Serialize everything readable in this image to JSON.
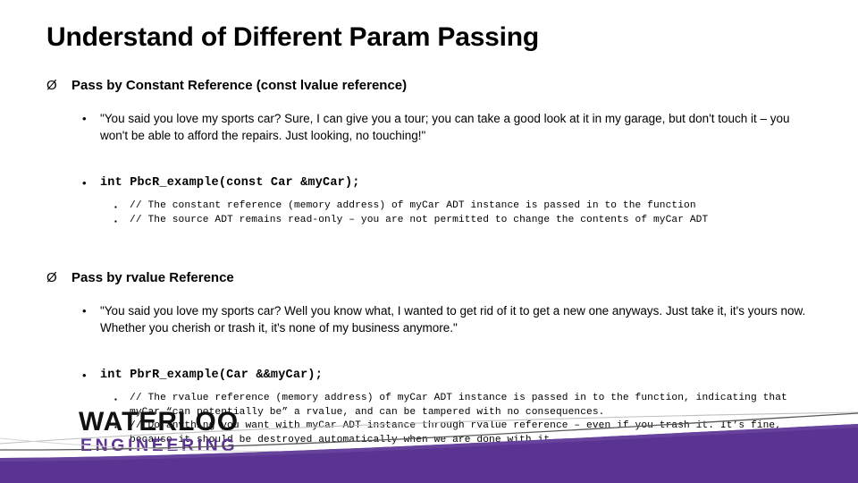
{
  "slide": {
    "title": "Understand of Different Param Passing",
    "markers": {
      "arrow": "Ø",
      "dot": "•",
      "square": "▪"
    },
    "sections": [
      {
        "heading": "Pass by Constant Reference (const lvalue reference)",
        "quote": "\"You said you love my sports car? Sure, I can give you a tour; you can take a good look at it in my garage, but don't touch it – you won't be able to afford the repairs.  Just looking, no touching!\"",
        "code": "int PbcR_example(const Car &myCar);",
        "comments": [
          "// The constant reference (memory address) of myCar ADT instance is passed in to the function",
          "// The source ADT remains read-only – you are not permitted to change the contents of myCar ADT"
        ]
      },
      {
        "heading": "Pass by rvalue Reference",
        "quote": "\"You said you love my sports car? Well you know what, I wanted to get rid of it to get a new one anyways.  Just take it, it's yours now.  Whether you cherish or trash it, it's none of my business anymore.\"",
        "code": "int PbrR_example(Car &&myCar);",
        "comments": [
          "// The rvalue reference (memory address) of myCar ADT instance is passed in to the function, indicating that myCar “can potentially be” a rvalue, and can be tampered with no consequences.",
          "// Do anything you want with myCar ADT instance through rvalue reference – even if you trash it. It’s fine, because it should be destroyed automatically when we are done with it."
        ]
      }
    ]
  },
  "logo": {
    "line1": "WATERLOO",
    "line2": "ENGINEERING"
  },
  "colors": {
    "purple": "#5B3392",
    "purple_light": "#6A46A0",
    "text": "#000000",
    "background": "#FFFFFF",
    "curve_gray": "#808080"
  }
}
